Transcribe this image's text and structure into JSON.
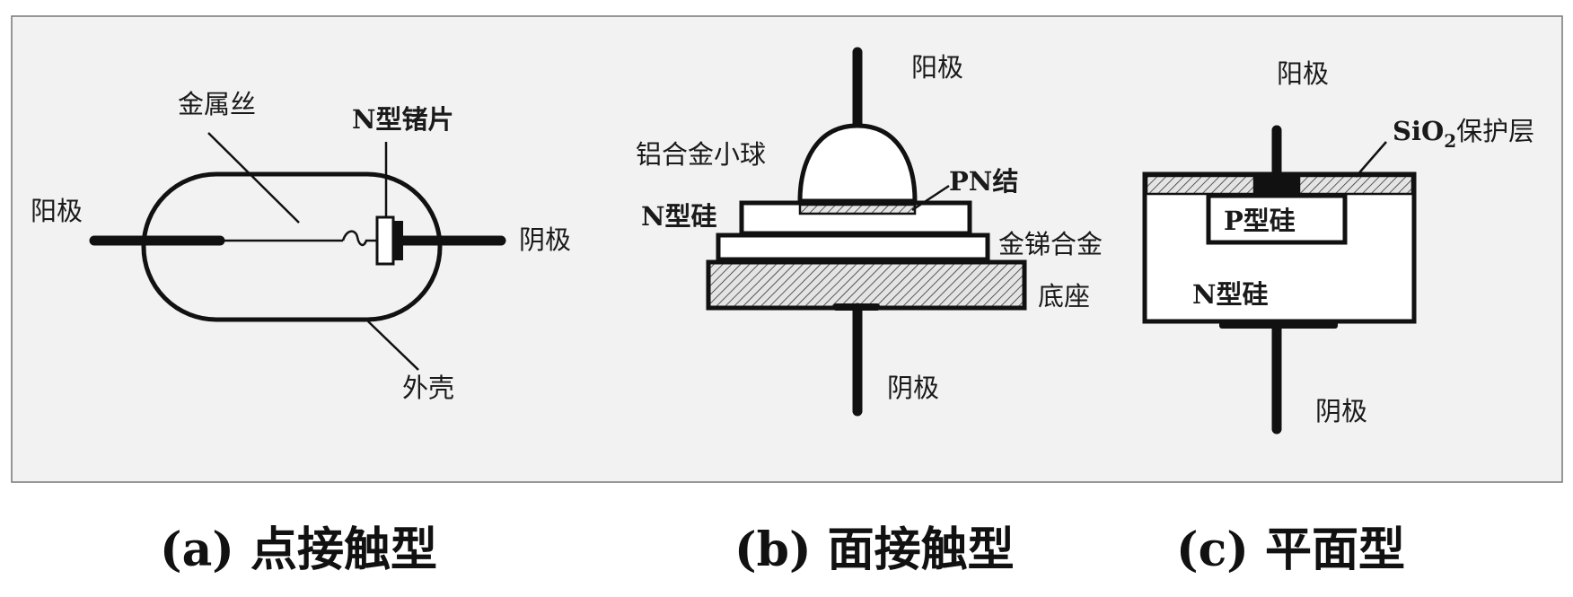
{
  "colors": {
    "background_panel": "#f2f2f2",
    "stroke": "#111111",
    "hatch_fill": "#d8d8d8"
  },
  "diagram_a": {
    "anode": "阳极",
    "wire": "金属丝",
    "germanium": "N型锗片",
    "cathode": "阴极",
    "shell": "外壳",
    "caption": "(a) 点接触型"
  },
  "diagram_b": {
    "anode": "阳极",
    "al_ball": "铝合金小球",
    "pn": "PN结",
    "n_si": "N型硅",
    "alloy": "金锑合金",
    "base": "底座",
    "cathode": "阴极",
    "caption": "(b) 面接触型"
  },
  "diagram_c": {
    "anode": "阳极",
    "sio2_main": "SiO",
    "sio2_sub": "2",
    "sio2_rest": "保护层",
    "p_si": "P型硅",
    "n_si": "N型硅",
    "cathode": "阴极",
    "caption": "(c) 平面型"
  }
}
